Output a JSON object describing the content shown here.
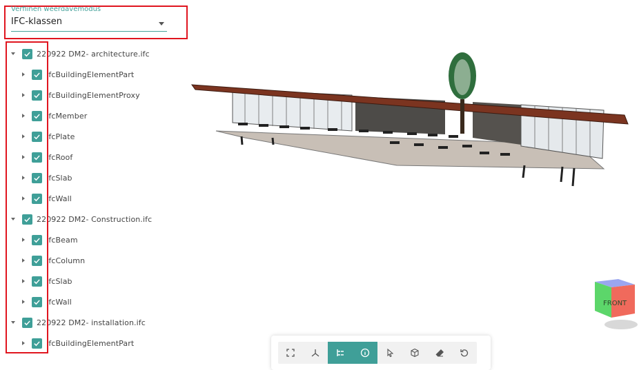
{
  "select": {
    "label": "Verfijnen weergavemodus",
    "value": "IFC-klassen"
  },
  "tree": [
    {
      "level": 0,
      "label": "220922 DM2- architecture.ifc"
    },
    {
      "level": 1,
      "label": "IfcBuildingElementPart"
    },
    {
      "level": 1,
      "label": "IfcBuildingElementProxy"
    },
    {
      "level": 1,
      "label": "IfcMember"
    },
    {
      "level": 1,
      "label": "IfcPlate"
    },
    {
      "level": 1,
      "label": "IfcRoof"
    },
    {
      "level": 1,
      "label": "IfcSlab"
    },
    {
      "level": 1,
      "label": "IfcWall"
    },
    {
      "level": 0,
      "label": "220922 DM2- Construction.ifc"
    },
    {
      "level": 1,
      "label": "IfcBeam"
    },
    {
      "level": 1,
      "label": "IfcColumn"
    },
    {
      "level": 1,
      "label": "IfcSlab"
    },
    {
      "level": 1,
      "label": "IfcWall"
    },
    {
      "level": 0,
      "label": "220922 DM2- installation.ifc"
    },
    {
      "level": 1,
      "label": "IfcBuildingElementPart"
    }
  ],
  "navcube": {
    "front_label": "FRONT"
  },
  "toolbar": {
    "accent": "#3f9f98",
    "buttons": [
      {
        "icon": "fullscreen-icon",
        "active": false
      },
      {
        "icon": "axes-icon",
        "active": false
      },
      {
        "icon": "tree-icon",
        "active": true
      },
      {
        "icon": "info-icon",
        "active": true
      },
      {
        "icon": "cursor-icon",
        "active": false
      },
      {
        "icon": "cube-icon",
        "active": false
      },
      {
        "icon": "eraser-icon",
        "active": false
      },
      {
        "icon": "reset-icon",
        "active": false
      }
    ]
  }
}
